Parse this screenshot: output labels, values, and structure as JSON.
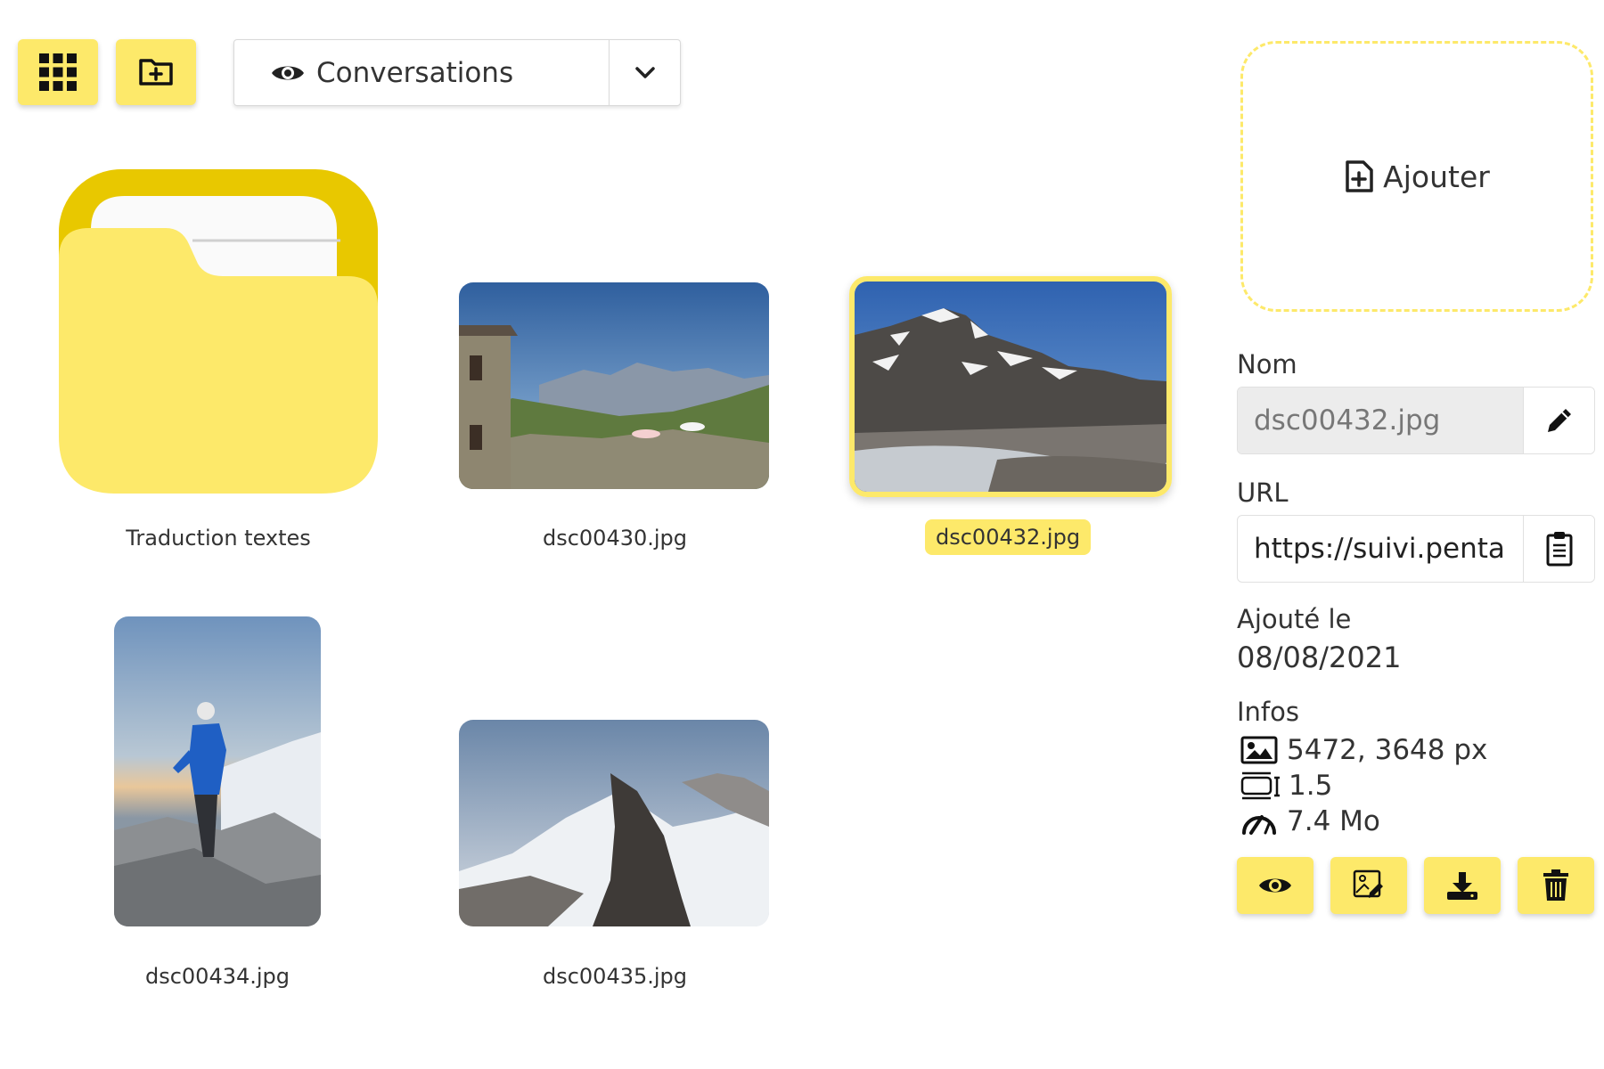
{
  "toolbar": {
    "grid_icon": "grid-icon",
    "new_folder_icon": "folder-plus-icon",
    "view_select": {
      "icon": "eye-icon",
      "selected": "Conversations"
    }
  },
  "items": [
    {
      "type": "folder",
      "name": "Traduction textes",
      "selected": false
    },
    {
      "type": "image",
      "name": "dsc00430.jpg",
      "selected": false
    },
    {
      "type": "image",
      "name": "dsc00432.jpg",
      "selected": true
    },
    {
      "type": "image",
      "name": "dsc00434.jpg",
      "selected": false
    },
    {
      "type": "image",
      "name": "dsc00435.jpg",
      "selected": false
    }
  ],
  "panel": {
    "dropzone_label": "Ajouter",
    "name_label": "Nom",
    "name_value": "dsc00432.jpg",
    "url_label": "URL",
    "url_value": "https://suivi.penta",
    "added_label": "Ajouté le",
    "added_value": "08/08/2021",
    "infos_label": "Infos",
    "infos": [
      {
        "icon": "image-icon",
        "value": "5472, 3648 px"
      },
      {
        "icon": "ratio-icon",
        "value": "1.5"
      },
      {
        "icon": "gauge-icon",
        "value": "7.4 Mo"
      }
    ],
    "actions": [
      {
        "icon": "eye-icon"
      },
      {
        "icon": "image-edit-icon"
      },
      {
        "icon": "download-icon"
      },
      {
        "icon": "trash-icon"
      }
    ]
  },
  "colors": {
    "accent": "#fde96a",
    "folder_back": "#e8c800",
    "folder_front": "#fde96a"
  }
}
